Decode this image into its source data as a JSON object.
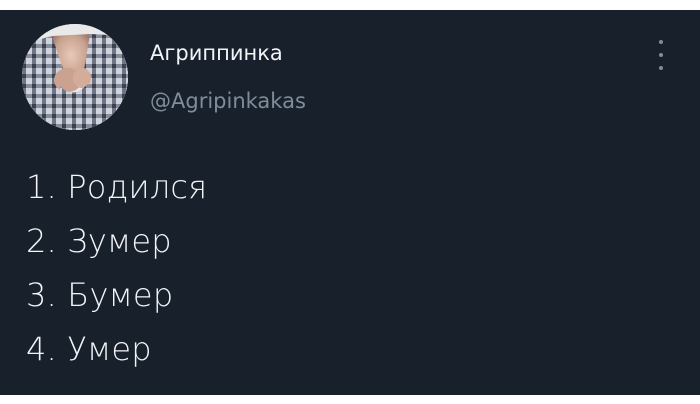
{
  "tweet": {
    "author": {
      "display_name": "Агриппинка",
      "handle": "@Agripinkakas",
      "avatar_icon": "profile-photo"
    },
    "menu_icon": "more-vertical-icon",
    "lines": [
      "1. Родился",
      "2. Зумер",
      "3. Бумер",
      "4. Умер"
    ]
  },
  "colors": {
    "background": "#18202b",
    "primary_text": "#f2f4f7",
    "secondary_text": "#7f8c9a"
  }
}
